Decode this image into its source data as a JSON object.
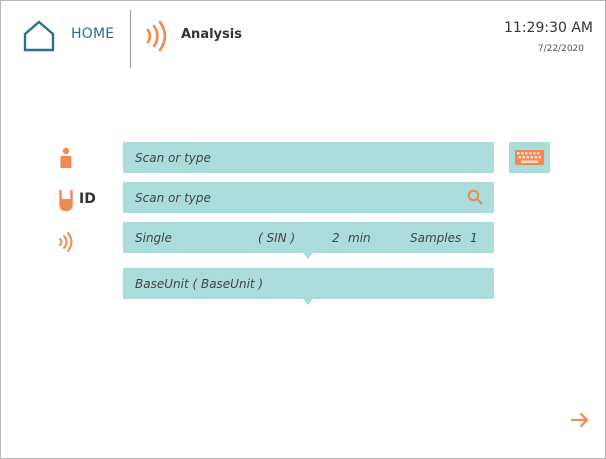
{
  "header": {
    "home_label": "HOME",
    "page_title": "Analysis",
    "time": "11:29:30 AM",
    "date": "7/22/2020"
  },
  "form": {
    "operator_placeholder": "Scan or type",
    "sample_id_placeholder": "Scan or type",
    "id_label": "ID",
    "mode": {
      "name": "Single",
      "code": "( SIN )",
      "duration_value": "2",
      "duration_unit": "min",
      "samples_label": "Samples",
      "samples_count": "1"
    },
    "unit_selection": "BaseUnit ( BaseUnit )"
  },
  "icons": {
    "home": "home-icon",
    "analysis": "signal-waves-icon",
    "operator": "person-icon",
    "sample": "sample-tube-icon",
    "mode": "signal-waves-icon",
    "search": "search-icon",
    "keyboard": "keyboard-icon",
    "next": "arrow-right-icon"
  },
  "colors": {
    "accent": "#f08a52",
    "field_bg": "#abdcdc",
    "home_blue": "#2f6f87"
  }
}
